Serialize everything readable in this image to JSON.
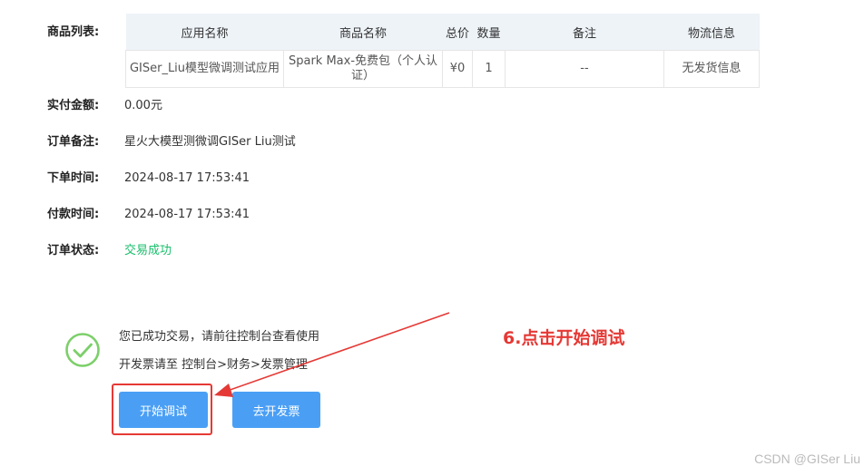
{
  "product_list": {
    "label": "商品列表:",
    "columns": [
      "应用名称",
      "商品名称",
      "总价",
      "数量",
      "备注",
      "物流信息"
    ],
    "rows": [
      [
        "GISer_Liu模型微调测试应用",
        "Spark Max-免费包（个人认证）",
        "¥0",
        "1",
        "--",
        "无发货信息"
      ]
    ]
  },
  "order": {
    "amount_label": "实付金额:",
    "amount_value": "0.00元",
    "note_label": "订单备注:",
    "note_value": "星火大模型测微调GISer Liu测试",
    "created_label": "下单时间:",
    "created_value": "2024-08-17 17:53:41",
    "paid_label": "付款时间:",
    "paid_value": "2024-08-17 17:53:41",
    "status_label": "订单状态:",
    "status_value": "交易成功"
  },
  "success": {
    "line1": "您已成功交易，请前往控制台查看使用",
    "line2": "开发票请至 控制台>财务>发票管理",
    "start_debug_button": "开始调试",
    "invoice_button": "去开发票"
  },
  "annotation": {
    "text": "6.点击开始调试",
    "color": "#e53935"
  },
  "watermark": "CSDN @GISer Liu",
  "colors": {
    "primary_button": "#4a9ff5",
    "success": "#19be6b",
    "table_header": "#eef3f8"
  }
}
